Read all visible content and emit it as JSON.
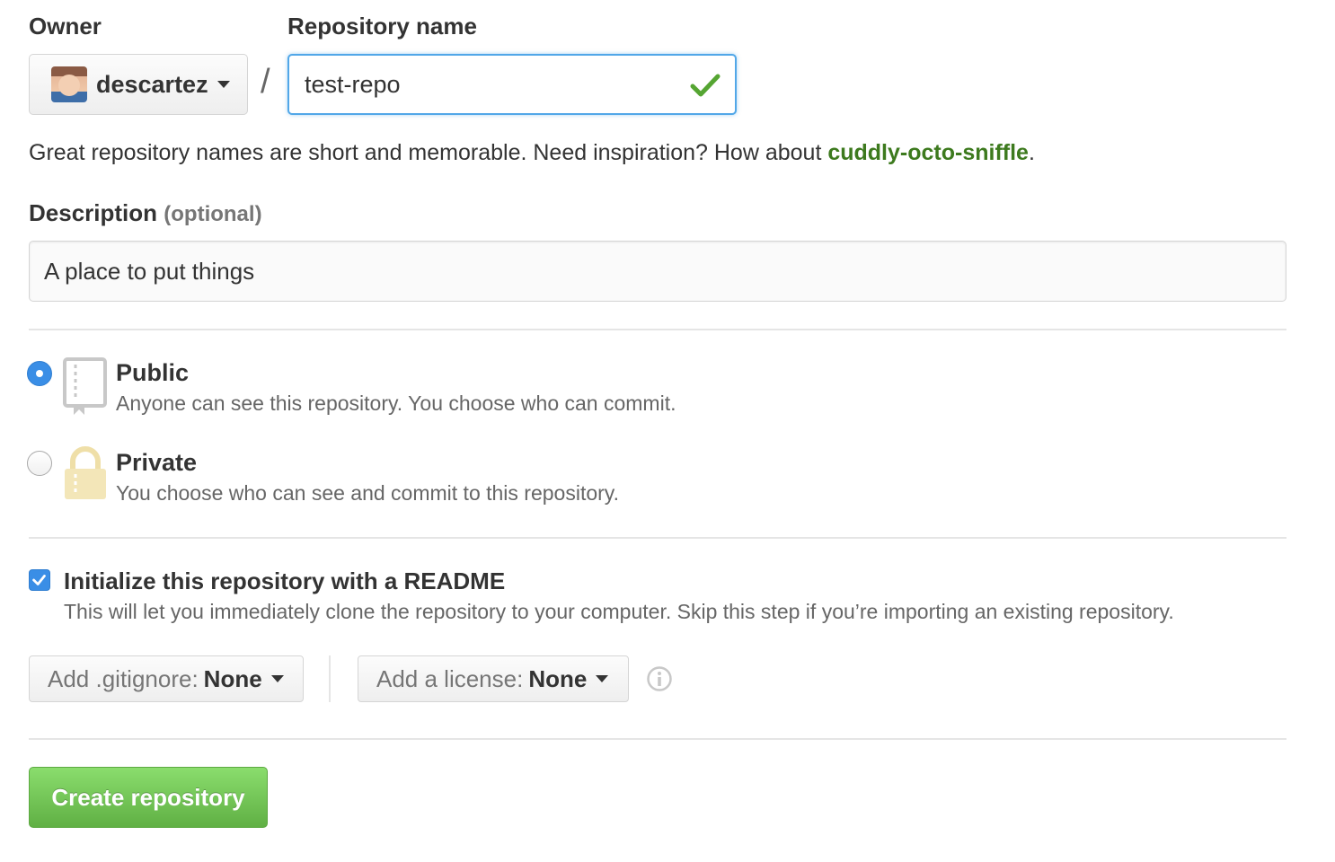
{
  "owner": {
    "label": "Owner",
    "value": "descartez"
  },
  "repo_name": {
    "label": "Repository name",
    "value": "test-repo",
    "separator": "/"
  },
  "hint": {
    "text": "Great repository names are short and memorable. Need inspiration? How about ",
    "suggestion": "cuddly-octo-sniffle",
    "end": "."
  },
  "description": {
    "label": "Description",
    "optional": "(optional)",
    "value": "A place to put things"
  },
  "visibility": {
    "selected": "public",
    "public": {
      "title": "Public",
      "desc": "Anyone can see this repository. You choose who can commit."
    },
    "private": {
      "title": "Private",
      "desc": "You choose who can see and commit to this repository."
    }
  },
  "readme": {
    "checked": true,
    "title": "Initialize this repository with a README",
    "desc": "This will let you immediately clone the repository to your computer. Skip this step if you’re importing an existing repository."
  },
  "gitignore": {
    "prefix": "Add .gitignore:",
    "value": "None"
  },
  "license": {
    "prefix": "Add a license:",
    "value": "None"
  },
  "submit": {
    "label": "Create repository"
  },
  "colors": {
    "accent": "#3a8ee6",
    "success": "#60b044",
    "suggestion": "#3d7a1e",
    "focus": "#51a7e8"
  },
  "icons": [
    "chevron-down-icon",
    "check-icon",
    "repo-book-icon",
    "lock-icon",
    "checkbox-check-icon",
    "info-icon"
  ]
}
